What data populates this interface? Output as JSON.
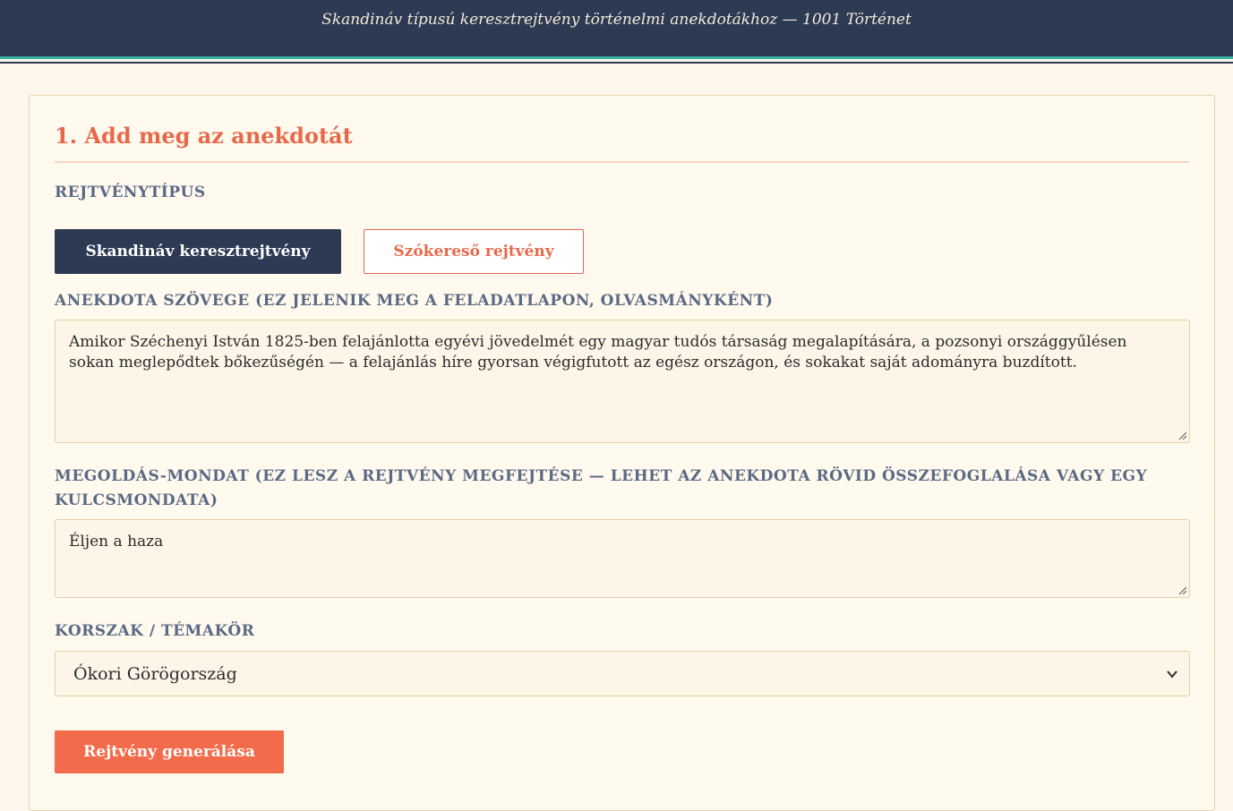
{
  "header": {
    "subtitle": "Skandináv típusú keresztrejtvény történelmi anekdotákhoz — 1001 Történet"
  },
  "form": {
    "section_title": "1. Add meg az anekdotát",
    "puzzle_type_label": "REJTVÉNYTÍPUS",
    "puzzle_types": [
      {
        "label": "Skandináv keresztrejtvény",
        "selected": true
      },
      {
        "label": "Szókereső rejtvény",
        "selected": false
      }
    ],
    "anecdote_label": "ANEKDOTA SZÖVEGE (EZ JELENIK MEG A FELADATLAPON, OLVASMÁNYKÉNT)",
    "anecdote_value": "Amikor Széchenyi István 1825-ben felajánlotta egyévi jövedelmét egy magyar tudós társaság megalapítására, a pozsonyi országgyűlésen sokan meglepődtek bőkezűségén — a felajánlás híre gyorsan végigfutott az egész országon, és sokakat saját adományra buzdított.",
    "solution_label": "MEGOLDÁS-MONDAT (EZ LESZ A REJTVÉNY MEGFEJTÉSE — LEHET AZ ANEKDOTA RÖVID ÖSSZEFOGLALÁSA VAGY EGY KULCSMONDATA)",
    "solution_value": "Éljen a haza",
    "era_label": "KORSZAK / TÉMAKÖR",
    "era_selected": "Ókori Görögország",
    "generate_label": "Rejtvény generálása"
  },
  "colors": {
    "header_bg": "#2c3a54",
    "accent": "#e8694a",
    "teal_line": "#3bb3a8",
    "page_bg": "#fdf6ec"
  }
}
